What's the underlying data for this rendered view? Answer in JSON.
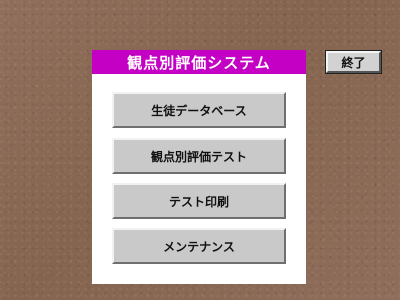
{
  "app": {
    "title": "観点別評価システム"
  },
  "menu": {
    "items": [
      {
        "label": "生徒データベース"
      },
      {
        "label": "観点別評価テスト"
      },
      {
        "label": "テスト印刷"
      },
      {
        "label": "メンテナンス"
      }
    ]
  },
  "toolbar": {
    "exit_label": "終了"
  },
  "colors": {
    "title_bar": "#c400c4",
    "background": "#8a6a58",
    "panel": "#ffffff",
    "button_face": "#c9c9c9"
  }
}
